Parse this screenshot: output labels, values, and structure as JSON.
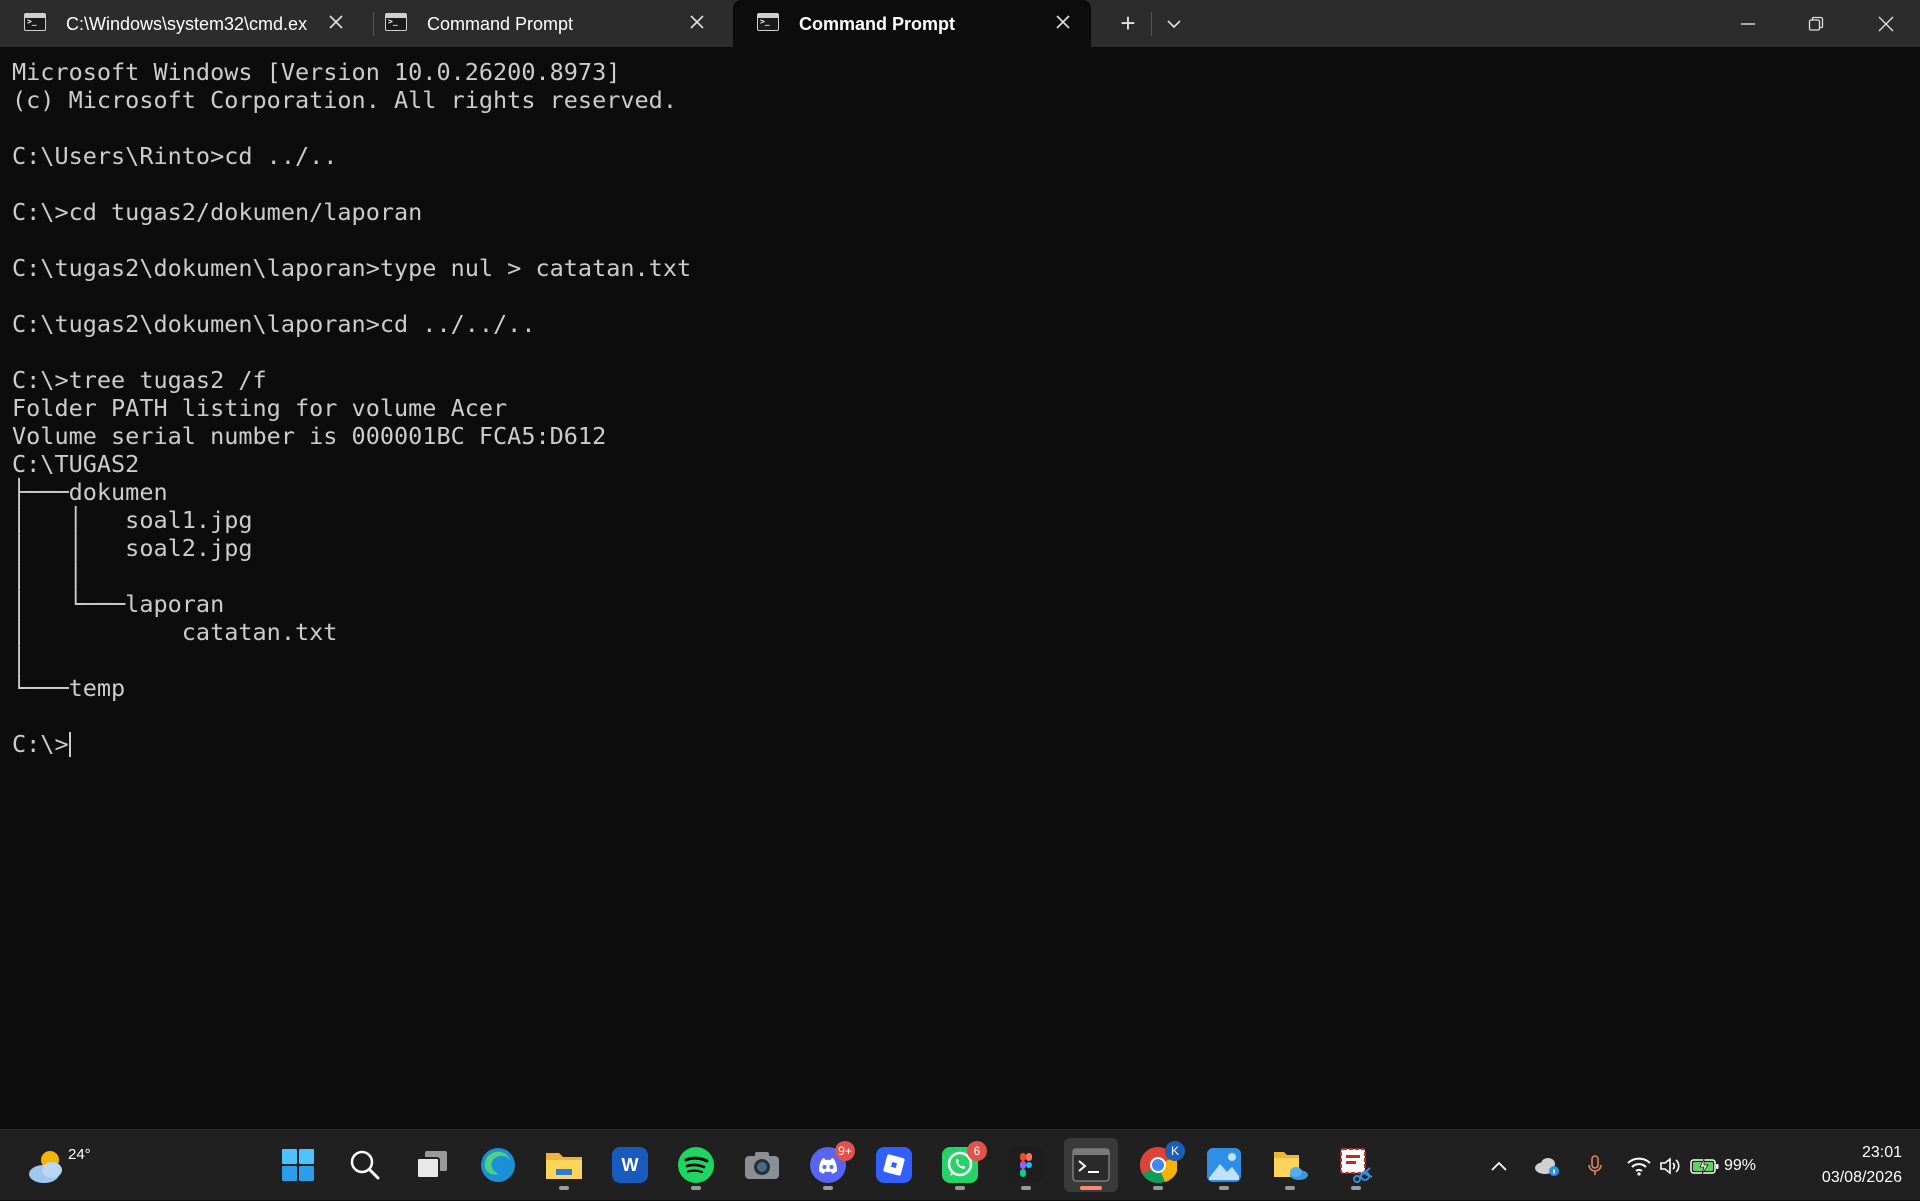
{
  "window": {
    "tabs": [
      {
        "title": "C:\\Windows\\system32\\cmd.ex",
        "active": false
      },
      {
        "title": "Command Prompt",
        "active": false
      },
      {
        "title": "Command Prompt",
        "active": true
      }
    ],
    "new_tab_symbol": "+",
    "tab_dropdown_icon": "chevron-down-icon",
    "controls": [
      "minimize-icon",
      "restore-icon",
      "close-icon"
    ]
  },
  "console": {
    "lines": [
      "Microsoft Windows [Version 10.0.26200.8973]",
      "(c) Microsoft Corporation. All rights reserved.",
      "",
      "C:\\Users\\Rinto>cd ../..",
      "",
      "C:\\>cd tugas2/dokumen/laporan",
      "",
      "C:\\tugas2\\dokumen\\laporan>type nul > catatan.txt",
      "",
      "C:\\tugas2\\dokumen\\laporan>cd ../../..",
      "",
      "C:\\>tree tugas2 /f",
      "Folder PATH listing for volume Acer",
      "Volume serial number is 000001BC FCA5:D612",
      "C:\\TUGAS2",
      "├───dokumen",
      "│   │   soal1.jpg",
      "│   │   soal2.jpg",
      "│   │",
      "│   └───laporan",
      "│           catatan.txt",
      "│",
      "└───temp",
      ""
    ],
    "prompt": "C:\\>",
    "colors": {
      "background": "#0c0c0c",
      "text": "#cccccc"
    }
  },
  "taskbar": {
    "weather": {
      "temperature": "24°",
      "icon": "partly-cloudy-icon"
    },
    "apps": [
      {
        "name": "start-icon"
      },
      {
        "name": "search-icon"
      },
      {
        "name": "task-view-icon"
      },
      {
        "name": "edge-icon"
      },
      {
        "name": "file-explorer-icon",
        "running": true
      },
      {
        "name": "word-icon",
        "letter": "W"
      },
      {
        "name": "spotify-icon",
        "running": true
      },
      {
        "name": "camera-icon"
      },
      {
        "name": "discord-icon",
        "badge": "9+",
        "running": true
      },
      {
        "name": "roblox-icon"
      },
      {
        "name": "whatsapp-icon",
        "badge": "6",
        "running": true
      },
      {
        "name": "figma-icon",
        "running": true
      },
      {
        "name": "terminal-icon",
        "active": true
      },
      {
        "name": "chrome-icon",
        "profile": "K",
        "running": true
      },
      {
        "name": "photos-icon",
        "running": true
      },
      {
        "name": "onedrive-folder-icon",
        "running": true
      },
      {
        "name": "snipping-tool-icon",
        "running": true
      }
    ],
    "tray": {
      "battery": "99%",
      "time": "23:01",
      "date": "03/08/2026"
    }
  }
}
